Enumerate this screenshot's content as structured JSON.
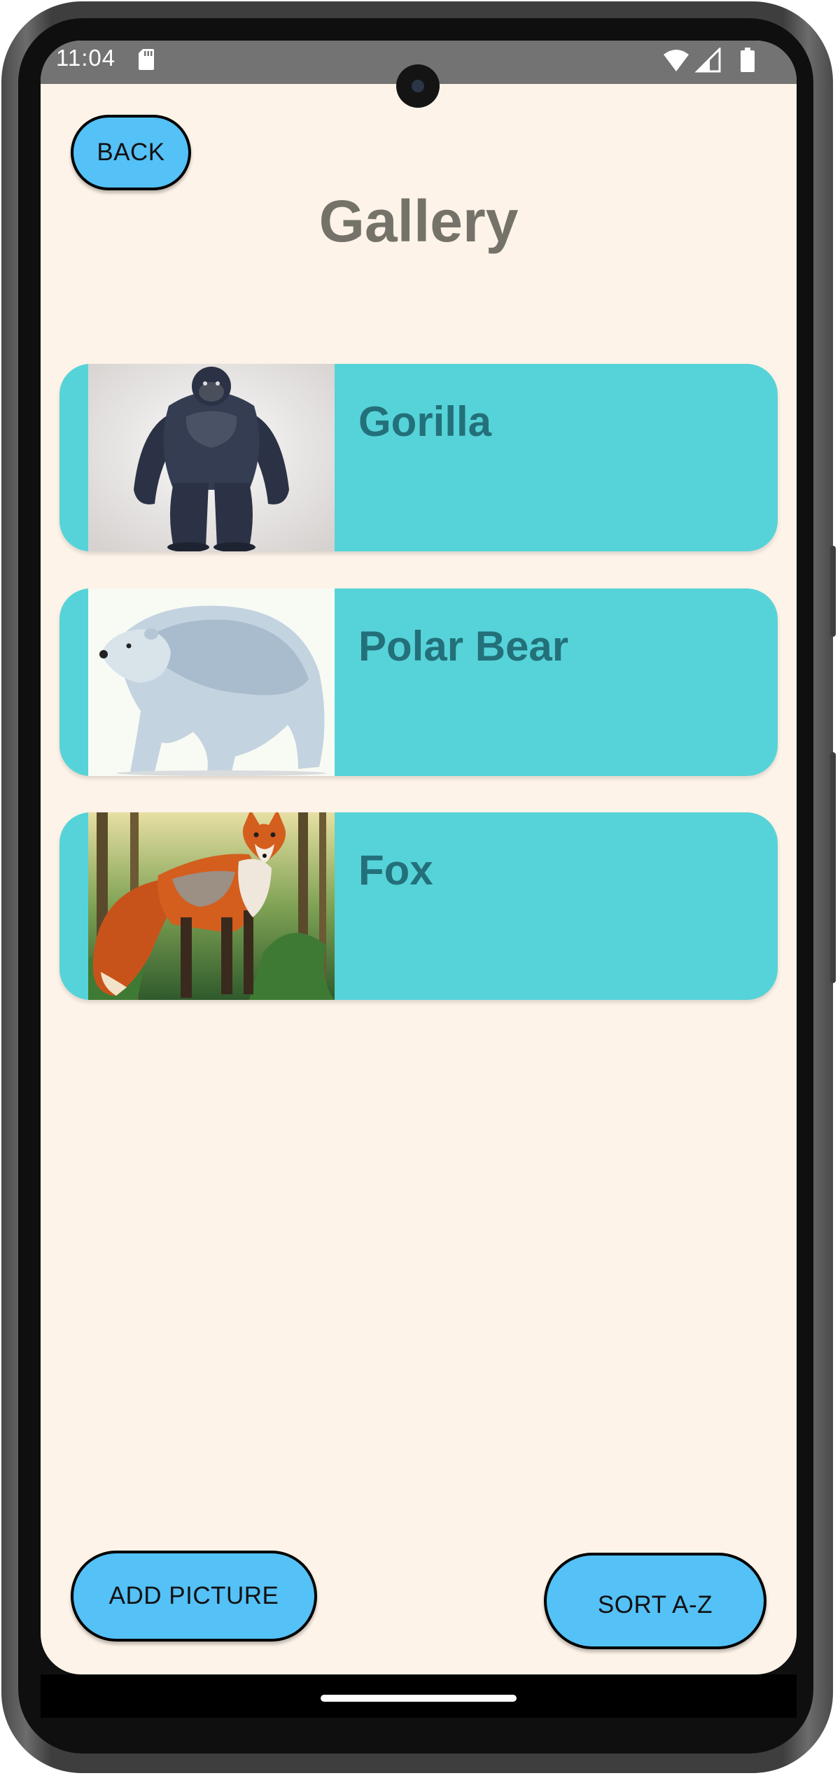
{
  "status_bar": {
    "time": "11:04",
    "icons": [
      "sd-card-icon",
      "wifi-icon",
      "signal-icon",
      "battery-icon"
    ]
  },
  "header": {
    "back_label": "BACK",
    "title": "Gallery"
  },
  "gallery": {
    "items": [
      {
        "label": "Gorilla",
        "image": "gorilla-image"
      },
      {
        "label": "Polar Bear",
        "image": "polar-bear-image"
      },
      {
        "label": "Fox",
        "image": "fox-image"
      }
    ]
  },
  "footer": {
    "add_picture_label": "ADD PICTURE",
    "sort_label": "SORT A-Z"
  },
  "colors": {
    "background": "#fdf3e8",
    "button": "#54c1f7",
    "card": "#56d3d8",
    "card_text": "#23707a",
    "title": "#757269"
  }
}
